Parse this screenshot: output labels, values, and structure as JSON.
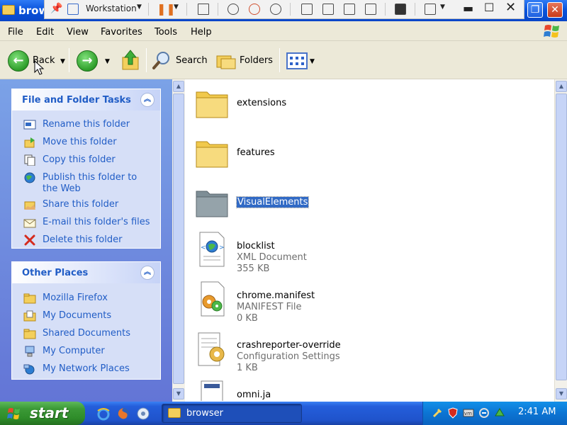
{
  "window": {
    "title": "browser"
  },
  "vmware": {
    "vm_name": "Workstation"
  },
  "menu": [
    "File",
    "Edit",
    "View",
    "Favorites",
    "Tools",
    "Help"
  ],
  "toolbar": {
    "back_label": "Back",
    "search_label": "Search",
    "folders_label": "Folders"
  },
  "file_tasks": {
    "title": "File and Folder Tasks",
    "items": [
      {
        "label": "Rename this folder",
        "icon": "rename-icon"
      },
      {
        "label": "Move this folder",
        "icon": "move-icon"
      },
      {
        "label": "Copy this folder",
        "icon": "copy-icon"
      },
      {
        "label": "Publish this folder to the Web",
        "icon": "publish-web-icon"
      },
      {
        "label": "Share this folder",
        "icon": "share-icon"
      },
      {
        "label": "E-mail this folder's files",
        "icon": "email-icon"
      },
      {
        "label": "Delete this folder",
        "icon": "delete-icon"
      }
    ]
  },
  "other_places": {
    "title": "Other Places",
    "items": [
      {
        "label": "Mozilla Firefox",
        "icon": "folder-icon"
      },
      {
        "label": "My Documents",
        "icon": "my-documents-icon"
      },
      {
        "label": "Shared Documents",
        "icon": "folder-icon"
      },
      {
        "label": "My Computer",
        "icon": "my-computer-icon"
      },
      {
        "label": "My Network Places",
        "icon": "network-icon"
      }
    ]
  },
  "files": [
    {
      "name": "extensions",
      "type": "",
      "size": "",
      "kind": "folder"
    },
    {
      "name": "features",
      "type": "",
      "size": "",
      "kind": "folder"
    },
    {
      "name": "VisualElements",
      "type": "",
      "size": "",
      "kind": "folder-selected"
    },
    {
      "name": "blocklist",
      "type": "XML Document",
      "size": "355 KB",
      "kind": "xml"
    },
    {
      "name": "chrome.manifest",
      "type": "MANIFEST File",
      "size": "0 KB",
      "kind": "manifest"
    },
    {
      "name": "crashreporter-override",
      "type": "Configuration Settings",
      "size": "1 KB",
      "kind": "config"
    },
    {
      "name": "omni.ja",
      "type": "",
      "size": "",
      "kind": "generic"
    }
  ],
  "taskbar": {
    "start_label": "start",
    "active_task": "browser",
    "clock": "2:41 AM"
  },
  "colors": {
    "xp_blue": "#0A54DD",
    "task_link": "#215DC6",
    "selection": "#316AC5",
    "start_green": "#3C9A37"
  }
}
